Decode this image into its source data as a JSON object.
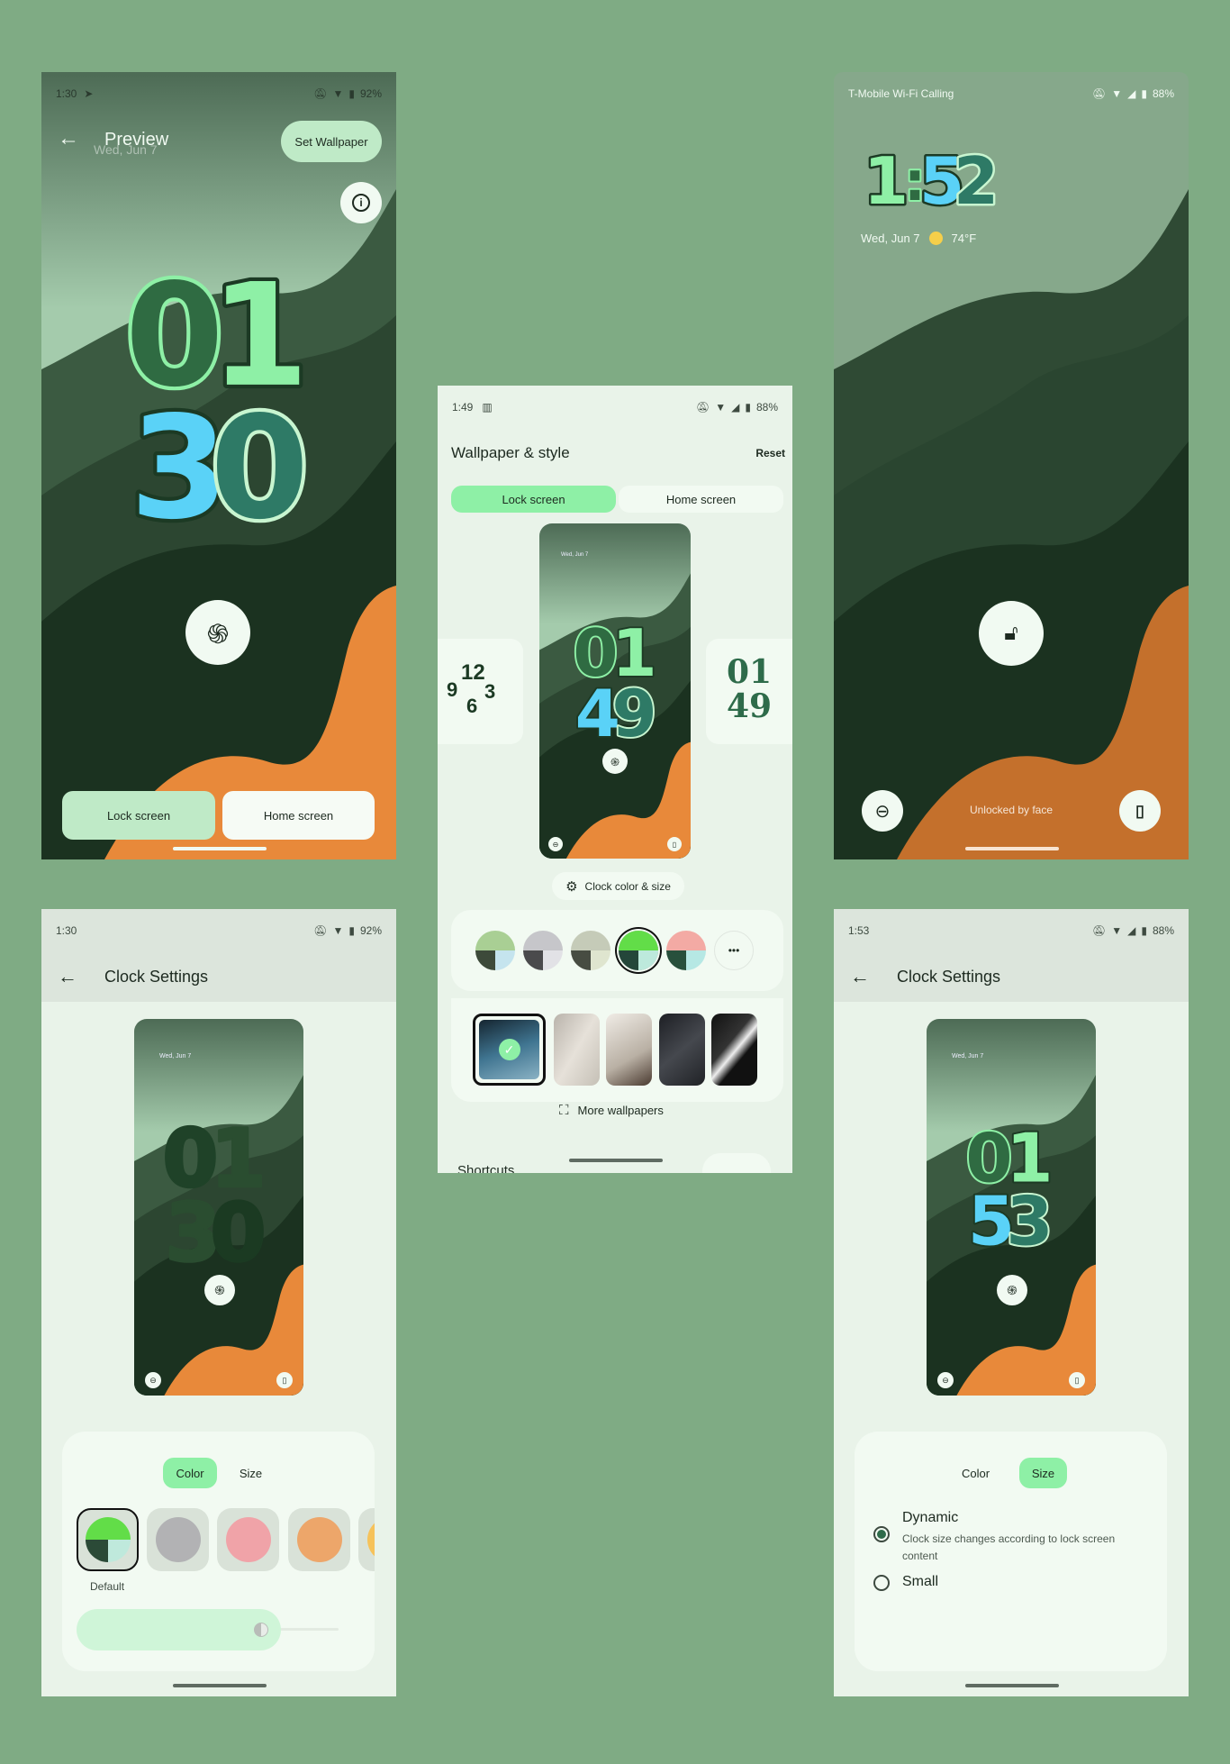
{
  "colors": {
    "background": "#7fab84",
    "accent": "#8ef0a6",
    "surface": "#e9f3e9",
    "orange": "#e8893a"
  },
  "preview_screen": {
    "status": {
      "time": "1:30",
      "battery": "92%",
      "icons": [
        "telegram-icon",
        "bell-off-icon",
        "wifi-icon",
        "battery-icon"
      ]
    },
    "title": "Preview",
    "date_ghost": "Wed, Jun 7",
    "set_wallpaper": "Set Wallpaper",
    "clock": [
      "0",
      "1",
      "3",
      "0"
    ],
    "lock_tab": "Lock screen",
    "home_tab": "Home screen"
  },
  "style_screen": {
    "status": {
      "time": "1:49",
      "battery": "88%"
    },
    "title": "Wallpaper & style",
    "reset": "Reset",
    "tabs": [
      {
        "label": "Lock screen",
        "selected": true
      },
      {
        "label": "Home screen",
        "selected": false
      }
    ],
    "preview_date": "Wed, Jun 7",
    "clock": [
      "0",
      "1",
      "4",
      "9"
    ],
    "clock_left": {
      "h12": "12",
      "h9": "9",
      "h3": "3",
      "h6": "6"
    },
    "clock_right": {
      "hours": "01",
      "minutes": "49"
    },
    "clock_button": "Clock color & size",
    "color_swatches": [
      {
        "top": "#a9cf94",
        "bl": "#3d4a3a",
        "br": "#c5e4ee",
        "selected": false
      },
      {
        "top": "#c6c6ca",
        "bl": "#4a4a4c",
        "br": "#e2e2e6",
        "selected": false
      },
      {
        "top": "#c5cbb8",
        "bl": "#474c42",
        "br": "#dfe5cf",
        "selected": false
      },
      {
        "top": "#62dd48",
        "bl": "#24463a",
        "br": "#bde9dc",
        "selected": true
      },
      {
        "top": "#f3aaa4",
        "bl": "#28503c",
        "br": "#b6e8e4",
        "selected": false
      }
    ],
    "more_colors": "•••",
    "more_wallpapers": "More wallpapers",
    "shortcuts": "Shortcuts"
  },
  "lock_screen": {
    "status": {
      "carrier": "T-Mobile Wi-Fi Calling",
      "battery": "88%"
    },
    "clock": [
      "1",
      ":",
      "5",
      "2"
    ],
    "date": "Wed, Jun 7",
    "temperature": "74°F",
    "unlock_message": "Unlocked by face"
  },
  "clock_settings_color": {
    "status": {
      "time": "1:30",
      "battery": "92%"
    },
    "title": "Clock Settings",
    "preview_date": "Wed, Jun 7",
    "clock": [
      "0",
      "1",
      "3",
      "0"
    ],
    "tabs": [
      {
        "label": "Color",
        "selected": true
      },
      {
        "label": "Size",
        "selected": false
      }
    ],
    "colors": [
      {
        "label": "Default",
        "selected": true
      },
      {
        "color": "#b2b2b4"
      },
      {
        "color": "#f0a3a8"
      },
      {
        "color": "#eda66a"
      },
      {
        "color": "#f6c25a"
      }
    ],
    "slider_value": 0.78
  },
  "clock_settings_size": {
    "status": {
      "time": "1:53",
      "battery": "88%"
    },
    "title": "Clock Settings",
    "preview_date": "Wed, Jun 7",
    "clock": [
      "0",
      "1",
      "5",
      "3"
    ],
    "tabs": [
      {
        "label": "Color",
        "selected": false
      },
      {
        "label": "Size",
        "selected": true
      }
    ],
    "options": [
      {
        "label": "Dynamic",
        "description": "Clock size changes according to lock screen content",
        "selected": true
      },
      {
        "label": "Small",
        "selected": false
      }
    ]
  }
}
